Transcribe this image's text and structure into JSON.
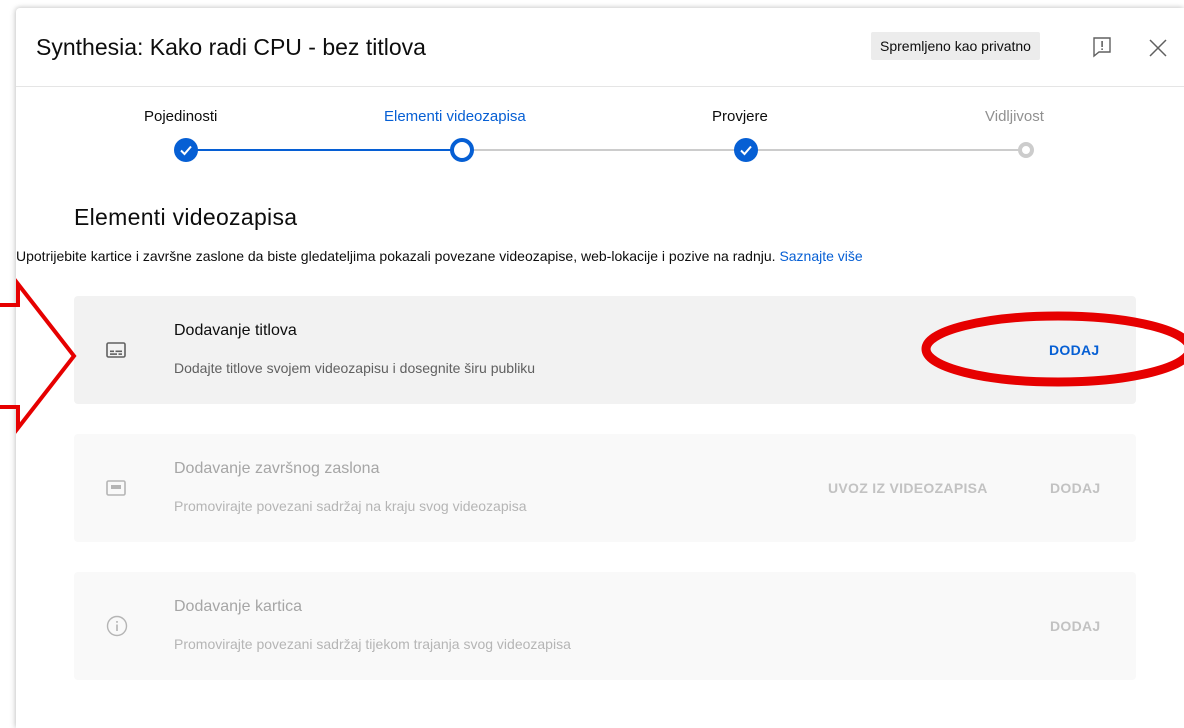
{
  "header": {
    "title": "Synthesia: Kako radi CPU - bez titlova",
    "saved_badge": "Spremljeno kao privatno",
    "feedback_icon": "feedback-flag-icon",
    "close_icon": "close-icon"
  },
  "stepper": {
    "steps": [
      {
        "label": "Pojedinosti",
        "state": "done"
      },
      {
        "label": "Elementi videozapisa",
        "state": "active"
      },
      {
        "label": "Provjere",
        "state": "done"
      },
      {
        "label": "Vidljivost",
        "state": "todo"
      }
    ],
    "colors": {
      "active": "#065fd4",
      "inactive": "#cccccc"
    }
  },
  "section": {
    "title": "Elementi videozapisa",
    "description": "Upotrijebite kartice i završne zaslone da biste gledateljima pokazali povezane videozapise, web-lokacije i pozive na radnju.",
    "learn_more": "Saznajte više"
  },
  "cards": [
    {
      "title": "Dodavanje titlova",
      "subtitle": "Dodajte titlove svojem videozapisu i dosegnite širu publiku",
      "icon": "subtitles-icon",
      "enabled": true,
      "actions": [
        "DODAJ"
      ]
    },
    {
      "title": "Dodavanje završnog zaslona",
      "subtitle": "Promovirajte povezani sadržaj na kraju svog videozapisa",
      "icon": "end-screen-icon",
      "enabled": false,
      "actions": [
        "UVOZ IZ VIDEOZAPISA",
        "DODAJ"
      ]
    },
    {
      "title": "Dodavanje kartica",
      "subtitle": "Promovirajte povezani sadržaj tijekom trajanja svog videozapisa",
      "icon": "info-icon",
      "enabled": false,
      "actions": [
        "DODAJ"
      ]
    }
  ],
  "annotations": {
    "color": "#e60000",
    "shapes": [
      "red-arrow",
      "red-ellipse"
    ]
  }
}
